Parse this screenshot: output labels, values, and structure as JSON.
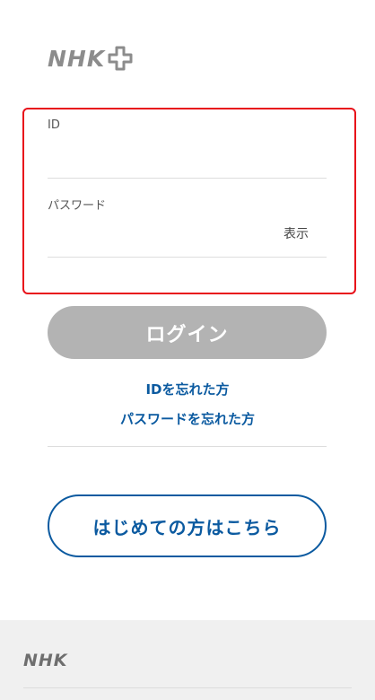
{
  "header": {
    "logo_text": "NHK"
  },
  "form": {
    "id_label": "ID",
    "id_value": "",
    "password_label": "パスワード",
    "password_value": "",
    "show_label": "表示"
  },
  "actions": {
    "login_label": "ログイン",
    "forgot_id_label": "IDを忘れた方",
    "forgot_password_label": "パスワードを忘れた方",
    "first_time_label": "はじめての方はこちら"
  },
  "footer": {
    "logo_text": "NHK"
  },
  "colors": {
    "accent": "#0b5aa0",
    "highlight_border": "#e8101a",
    "disabled_button": "#b3b3b3"
  }
}
